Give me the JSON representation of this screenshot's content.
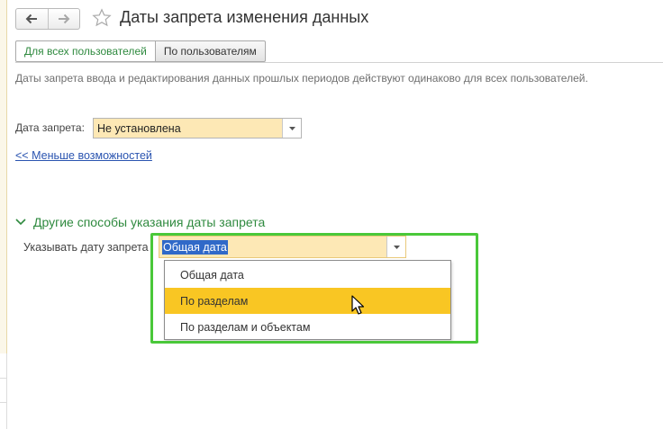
{
  "header": {
    "title": "Даты запрета изменения данных",
    "back_icon": "arrow-left-icon",
    "forward_icon": "arrow-right-icon",
    "favorite_icon": "star-icon"
  },
  "tabs": [
    {
      "label": "Для всех пользователей",
      "active": true
    },
    {
      "label": "По пользователям",
      "active": false
    }
  ],
  "info_text": "Даты запрета ввода и редактирования данных прошлых периодов действуют одинаково для всех пользователей.",
  "prohibition_date": {
    "label": "Дата запрета:",
    "value": "Не установлена"
  },
  "less_options_link": "<< Меньше возможностей",
  "other_methods": {
    "header": "Другие способы указания даты запрета",
    "field_label": "Указывать дату запрета",
    "selected_value": "Общая дата",
    "options": [
      "Общая дата",
      "По разделам",
      "По разделам и объектам"
    ],
    "hovered_option": "По разделам"
  },
  "colors": {
    "accent_green": "#2f8a3f",
    "field_yellow": "#fde8b5",
    "hover_yellow": "#f9c623",
    "link_blue": "#2a54b0",
    "highlight_frame": "#4ac83a",
    "selection_blue": "#3069c8"
  }
}
